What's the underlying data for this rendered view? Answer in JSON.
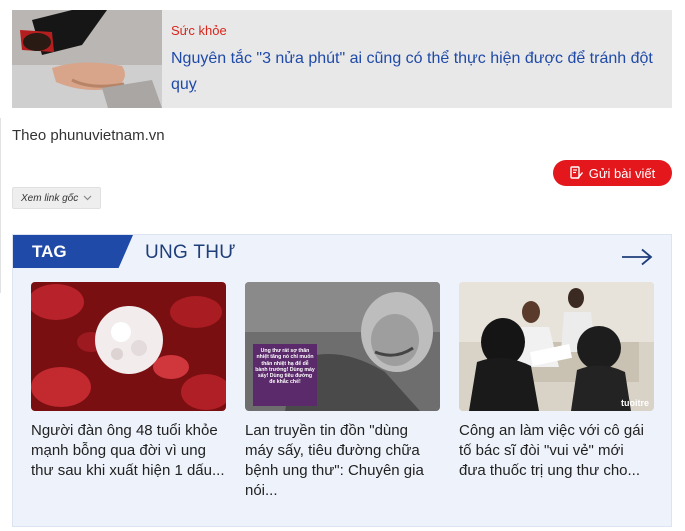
{
  "related": {
    "category": "Sức khỏe",
    "title": "Nguyên tắc \"3 nửa phút\" ai cũng có thể thực hiện được để tránh đột quỵ",
    "thumb_icon": "collapsed-person-photo"
  },
  "source": "Theo phunuvietnam.vn",
  "send_button": {
    "label": "Gửi bài viết",
    "icon": "edit-document-icon"
  },
  "view_source": {
    "label": "Xem link gốc",
    "icon": "chevron-down-icon"
  },
  "tag_section": {
    "tag_label": "TAG",
    "tag_name": "UNG THƯ",
    "arrow_icon": "arrow-right-icon",
    "cards": [
      {
        "title": "Người đàn ông 48 tuổi khỏe mạnh bỗng qua đời vì ung thư sau khi xuất hiện 1 dấu...",
        "image": "blood-cells-photo"
      },
      {
        "title": "Lan truyền tin đồn \"dùng máy sấy, tiêu đường chữa bệnh ung thư\": Chuyên gia nói...",
        "image": "hospital-patient-photo",
        "image_caption": "Ung thư rất sợ thân nhiệt tăng nó chỉ muốn thân nhiệt hạ để dễ bành trướng! Dùng máy sấy! Dùng tiêu đường đe khắc chế!"
      },
      {
        "title": "Công an làm việc với cô gái tố bác sĩ đòi \"vui vẻ\" mới đưa thuốc trị ung thư cho...",
        "image": "police-meeting-photo",
        "watermark": "tuoitre"
      }
    ]
  },
  "colors": {
    "accent_red": "#e4181c",
    "brand_blue": "#1f4aa8",
    "section_bg": "#eef2fa"
  }
}
